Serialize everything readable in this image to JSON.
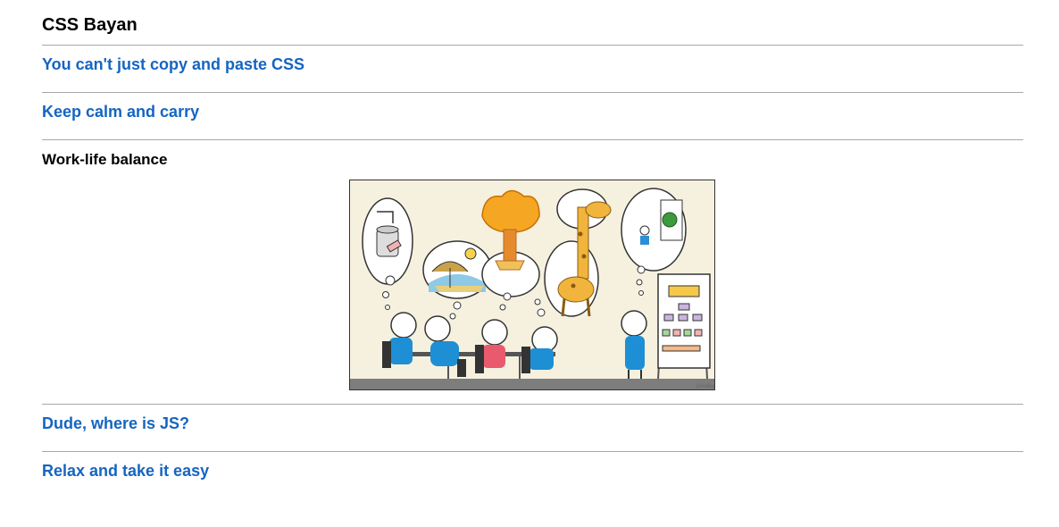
{
  "header": {
    "title": "CSS Bayan"
  },
  "accordion": {
    "items": [
      {
        "label": "You can't just copy and paste CSS",
        "state": "collapsed"
      },
      {
        "label": "Keep calm and carry",
        "state": "collapsed"
      },
      {
        "label": "Work-life balance",
        "state": "expanded"
      },
      {
        "label": "Dude, where is JS?",
        "state": "collapsed"
      },
      {
        "label": "Relax and take it easy",
        "state": "collapsed"
      }
    ]
  },
  "illustration": {
    "watermark": "pikabu",
    "thought_bubbles": [
      "database-icon",
      "beach-icon",
      "explosion-icon",
      "giraffe-icon",
      "comparison-icon"
    ]
  },
  "colors": {
    "link": "#1565c0",
    "active": "#000000",
    "divider": "#a8a8a8"
  }
}
